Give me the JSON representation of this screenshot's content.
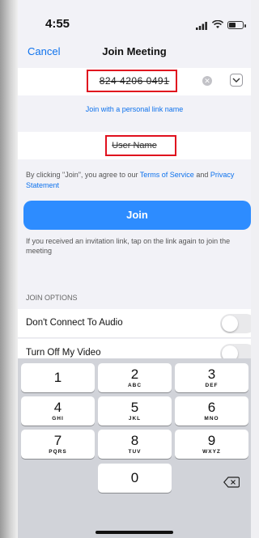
{
  "status_bar": {
    "time": "4:55"
  },
  "nav": {
    "cancel_label": "Cancel",
    "title": "Join Meeting"
  },
  "meeting_id": {
    "value": "824 4206 0491"
  },
  "personal_link_label": "Join with a personal link name",
  "user_name": {
    "value": "User Name"
  },
  "terms": {
    "prefix": "By clicking \"Join\", you agree to our ",
    "terms_link": "Terms of Service",
    "and": " and ",
    "privacy_link": "Privacy Statement"
  },
  "join_button_label": "Join",
  "invite_note": "If you received an invitation link, tap on the link again to join the meeting",
  "join_options": {
    "header": "JOIN OPTIONS",
    "items": [
      {
        "label": "Don't Connect To Audio",
        "on": false
      },
      {
        "label": "Turn Off My Video",
        "on": false
      }
    ]
  },
  "keypad": {
    "keys": [
      {
        "num": "1",
        "letters": ""
      },
      {
        "num": "2",
        "letters": "ABC"
      },
      {
        "num": "3",
        "letters": "DEF"
      },
      {
        "num": "4",
        "letters": "GHI"
      },
      {
        "num": "5",
        "letters": "JKL"
      },
      {
        "num": "6",
        "letters": "MNO"
      },
      {
        "num": "7",
        "letters": "PQRS"
      },
      {
        "num": "8",
        "letters": "TUV"
      },
      {
        "num": "9",
        "letters": "WXYZ"
      },
      {
        "num": "0",
        "letters": ""
      }
    ]
  },
  "colors": {
    "accent": "#2d8cff",
    "link": "#0e72ed",
    "highlight": "#e0101e"
  }
}
